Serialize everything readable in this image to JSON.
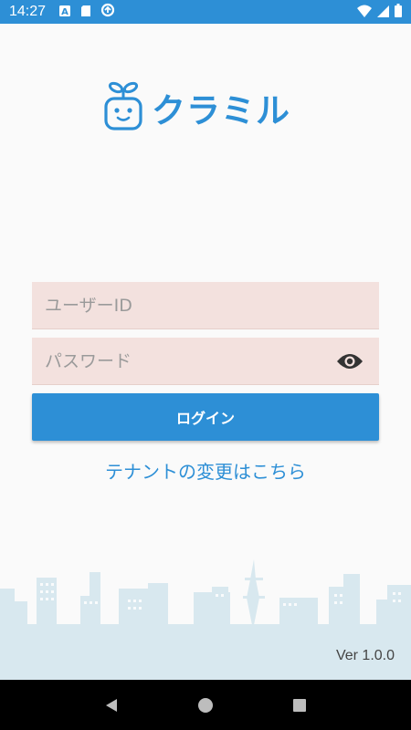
{
  "status_bar": {
    "time": "14:27",
    "left_icons": [
      "text-a-icon",
      "sd-card-icon",
      "data-saver-icon"
    ],
    "right_icons": [
      "wifi-icon",
      "signal-icon",
      "battery-icon"
    ]
  },
  "logo": {
    "text": "クラミル",
    "mascot_icon": "robot-mascot-icon",
    "color": "#2d8fd6"
  },
  "login_form": {
    "user_id": {
      "value": "",
      "placeholder": "ユーザーID"
    },
    "password": {
      "value": "",
      "placeholder": "パスワード",
      "toggle_icon": "eye-icon"
    },
    "login_button_label": "ログイン"
  },
  "tenant_link": "テナントの変更はこちら",
  "footer": {
    "version": "Ver 1.0.0"
  },
  "nav_bar": {
    "buttons": [
      "back-icon",
      "home-icon",
      "recents-icon"
    ]
  },
  "colors": {
    "accent": "#2d8fd6",
    "field_bg": "#f3e1de",
    "ground": "#d8e8ef"
  }
}
